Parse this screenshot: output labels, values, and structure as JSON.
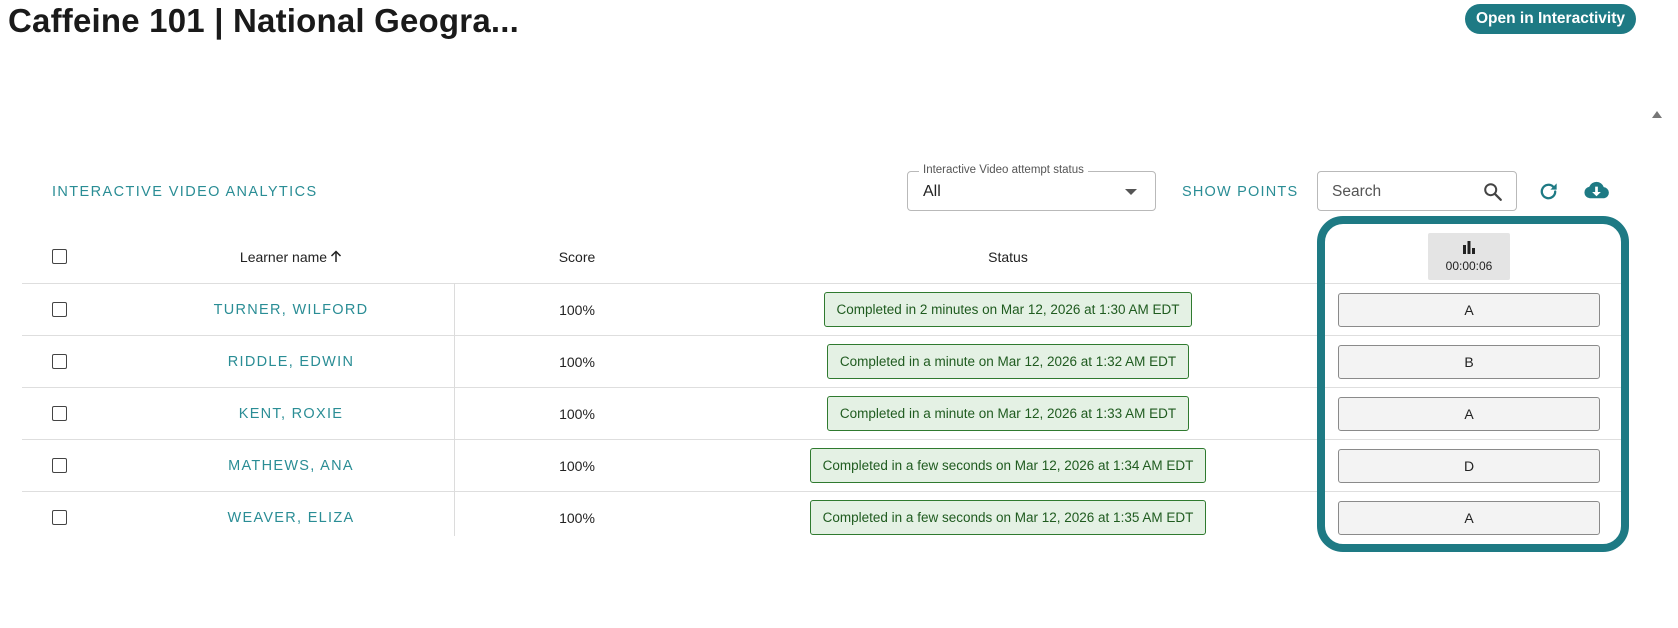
{
  "page": {
    "title": "Caffeine 101 | National Geogra...",
    "open_button": "Open in Interactivity"
  },
  "toolbar": {
    "section_title": "INTERACTIVE VIDEO ANALYTICS",
    "status_filter": {
      "label": "Interactive Video attempt status",
      "value": "All"
    },
    "show_points": "SHOW POINTS",
    "search": {
      "placeholder": "Search",
      "value": ""
    }
  },
  "table": {
    "headers": {
      "learner_name": "Learner name",
      "score": "Score",
      "status": "Status",
      "question_time": "00:00:06"
    },
    "rows": [
      {
        "name": "TURNER, WILFORD",
        "score": "100%",
        "status": "Completed in 2 minutes on Mar 12, 2026 at 1:30 AM EDT",
        "answer": "A"
      },
      {
        "name": "RIDDLE, EDWIN",
        "score": "100%",
        "status": "Completed in a minute on Mar 12, 2026 at 1:32 AM EDT",
        "answer": "B"
      },
      {
        "name": "KENT, ROXIE",
        "score": "100%",
        "status": "Completed in a minute on Mar 12, 2026 at 1:33 AM EDT",
        "answer": "A"
      },
      {
        "name": "MATHEWS, ANA",
        "score": "100%",
        "status": "Completed in a few seconds on Mar 12, 2026 at 1:34 AM EDT",
        "answer": "D"
      },
      {
        "name": "WEAVER, ELIZA",
        "score": "100%",
        "status": "Completed in a few seconds on Mar 12, 2026 at 1:35 AM EDT",
        "answer": "A"
      }
    ]
  },
  "icons": {
    "search": "search-icon",
    "refresh": "refresh-icon",
    "download": "cloud-download-icon",
    "sort": "arrow-up-icon",
    "question_stats": "bar-chart-icon",
    "dropdown": "caret-down-icon"
  },
  "colors": {
    "brand": "#1e7a84",
    "link": "#2a8d95",
    "status_bg": "#e4f1e4",
    "status_border": "#2f7a2f",
    "status_text": "#1f5b1f"
  }
}
